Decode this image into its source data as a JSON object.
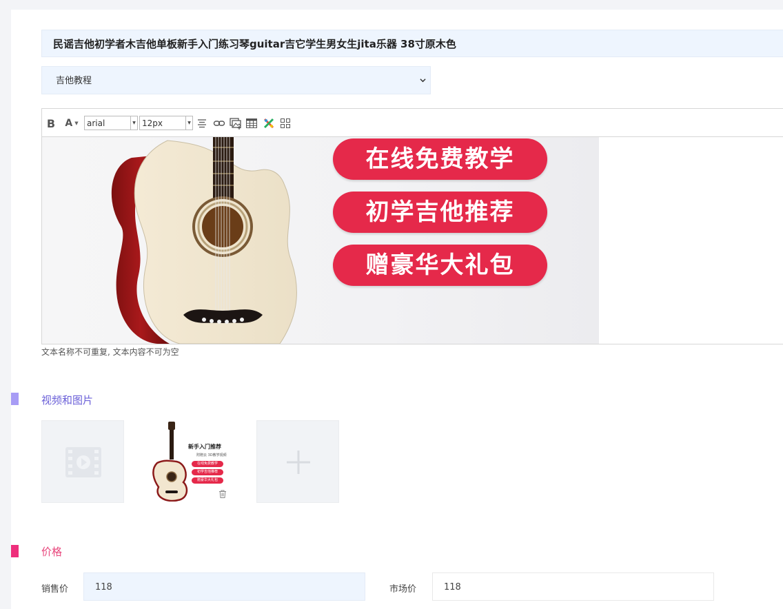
{
  "product": {
    "title": "民谣吉他初学者木吉他单板新手入门练习琴guitar吉它学生男女生jita乐器 38寸原木色",
    "category_selected": "吉他教程"
  },
  "editor": {
    "toolbar": {
      "bold": "B",
      "font_color": "A",
      "font_family": "arial",
      "font_size": "12px"
    },
    "banner": {
      "pills": [
        "在线免费教学",
        "初学吉他推荐",
        "赠豪华大礼包"
      ]
    },
    "hint": "文本名称不可重复, 文本内容不可为空"
  },
  "media": {
    "section_title": "视频和图片",
    "section_color": "#a79cf5",
    "title_color": "#6a5fd8",
    "thumbnail": {
      "title": "新手入门推荐",
      "subtitle": "附赠云 3D教学视频",
      "pills": [
        "在线免费教学",
        "初学吉他推荐",
        "赠豪华大礼包"
      ]
    },
    "video_icon": "film-play-icon",
    "delete_icon": "trash-icon",
    "add_icon": "plus-icon"
  },
  "price": {
    "section_title": "价格",
    "section_color": "#ee2f7c",
    "title_color": "#e8467c",
    "sale_label": "销售价",
    "sale_value": "118",
    "market_label": "市场价",
    "market_value": "118"
  }
}
